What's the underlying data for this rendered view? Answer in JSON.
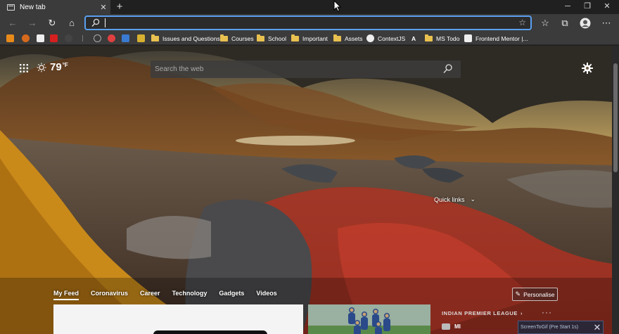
{
  "tab": {
    "title": "New tab",
    "close": "✕",
    "new_tab": "+"
  },
  "window_controls": {
    "minimize": "─",
    "restore": "❐",
    "close": "✕"
  },
  "toolbar": {
    "back": "←",
    "forward": "→",
    "refresh": "↻",
    "home": "⌂",
    "address_value": "",
    "favorite_star": "☆",
    "favorites": "☆",
    "collections": "⧉",
    "more": "⋯"
  },
  "bookmarks": [
    {
      "label": "Issues and Questions"
    },
    {
      "label": "Courses"
    },
    {
      "label": "School"
    },
    {
      "label": "Important"
    },
    {
      "label": "Assets"
    },
    {
      "label": "ContextJS"
    },
    {
      "label": "A"
    },
    {
      "label": "MS Todo"
    },
    {
      "label": "Frontend Mentor |..."
    }
  ],
  "weather": {
    "temp": "79",
    "unit": "°F"
  },
  "search": {
    "placeholder": "Search the web"
  },
  "quick_links": {
    "label": "Quick links",
    "chevron": "⌄"
  },
  "feed_nav": [
    {
      "label": "My Feed"
    },
    {
      "label": "Coronavirus"
    },
    {
      "label": "Career"
    },
    {
      "label": "Technology"
    },
    {
      "label": "Gadgets"
    },
    {
      "label": "Videos"
    }
  ],
  "personalise": {
    "label": "Personalise",
    "icon": "✎"
  },
  "ipl": {
    "title": "INDIAN PREMIER LEAGUE",
    "arrow": "›",
    "more": "···",
    "team": "MI"
  },
  "screen_recorder": {
    "label": "ScreenToGif (Pre Start 1s)",
    "close": "✕"
  },
  "colors": {
    "accent": "#5aa0f0",
    "chrome": "#3b3b3b",
    "tabstrip": "#202020",
    "folder": "#e8c050"
  }
}
